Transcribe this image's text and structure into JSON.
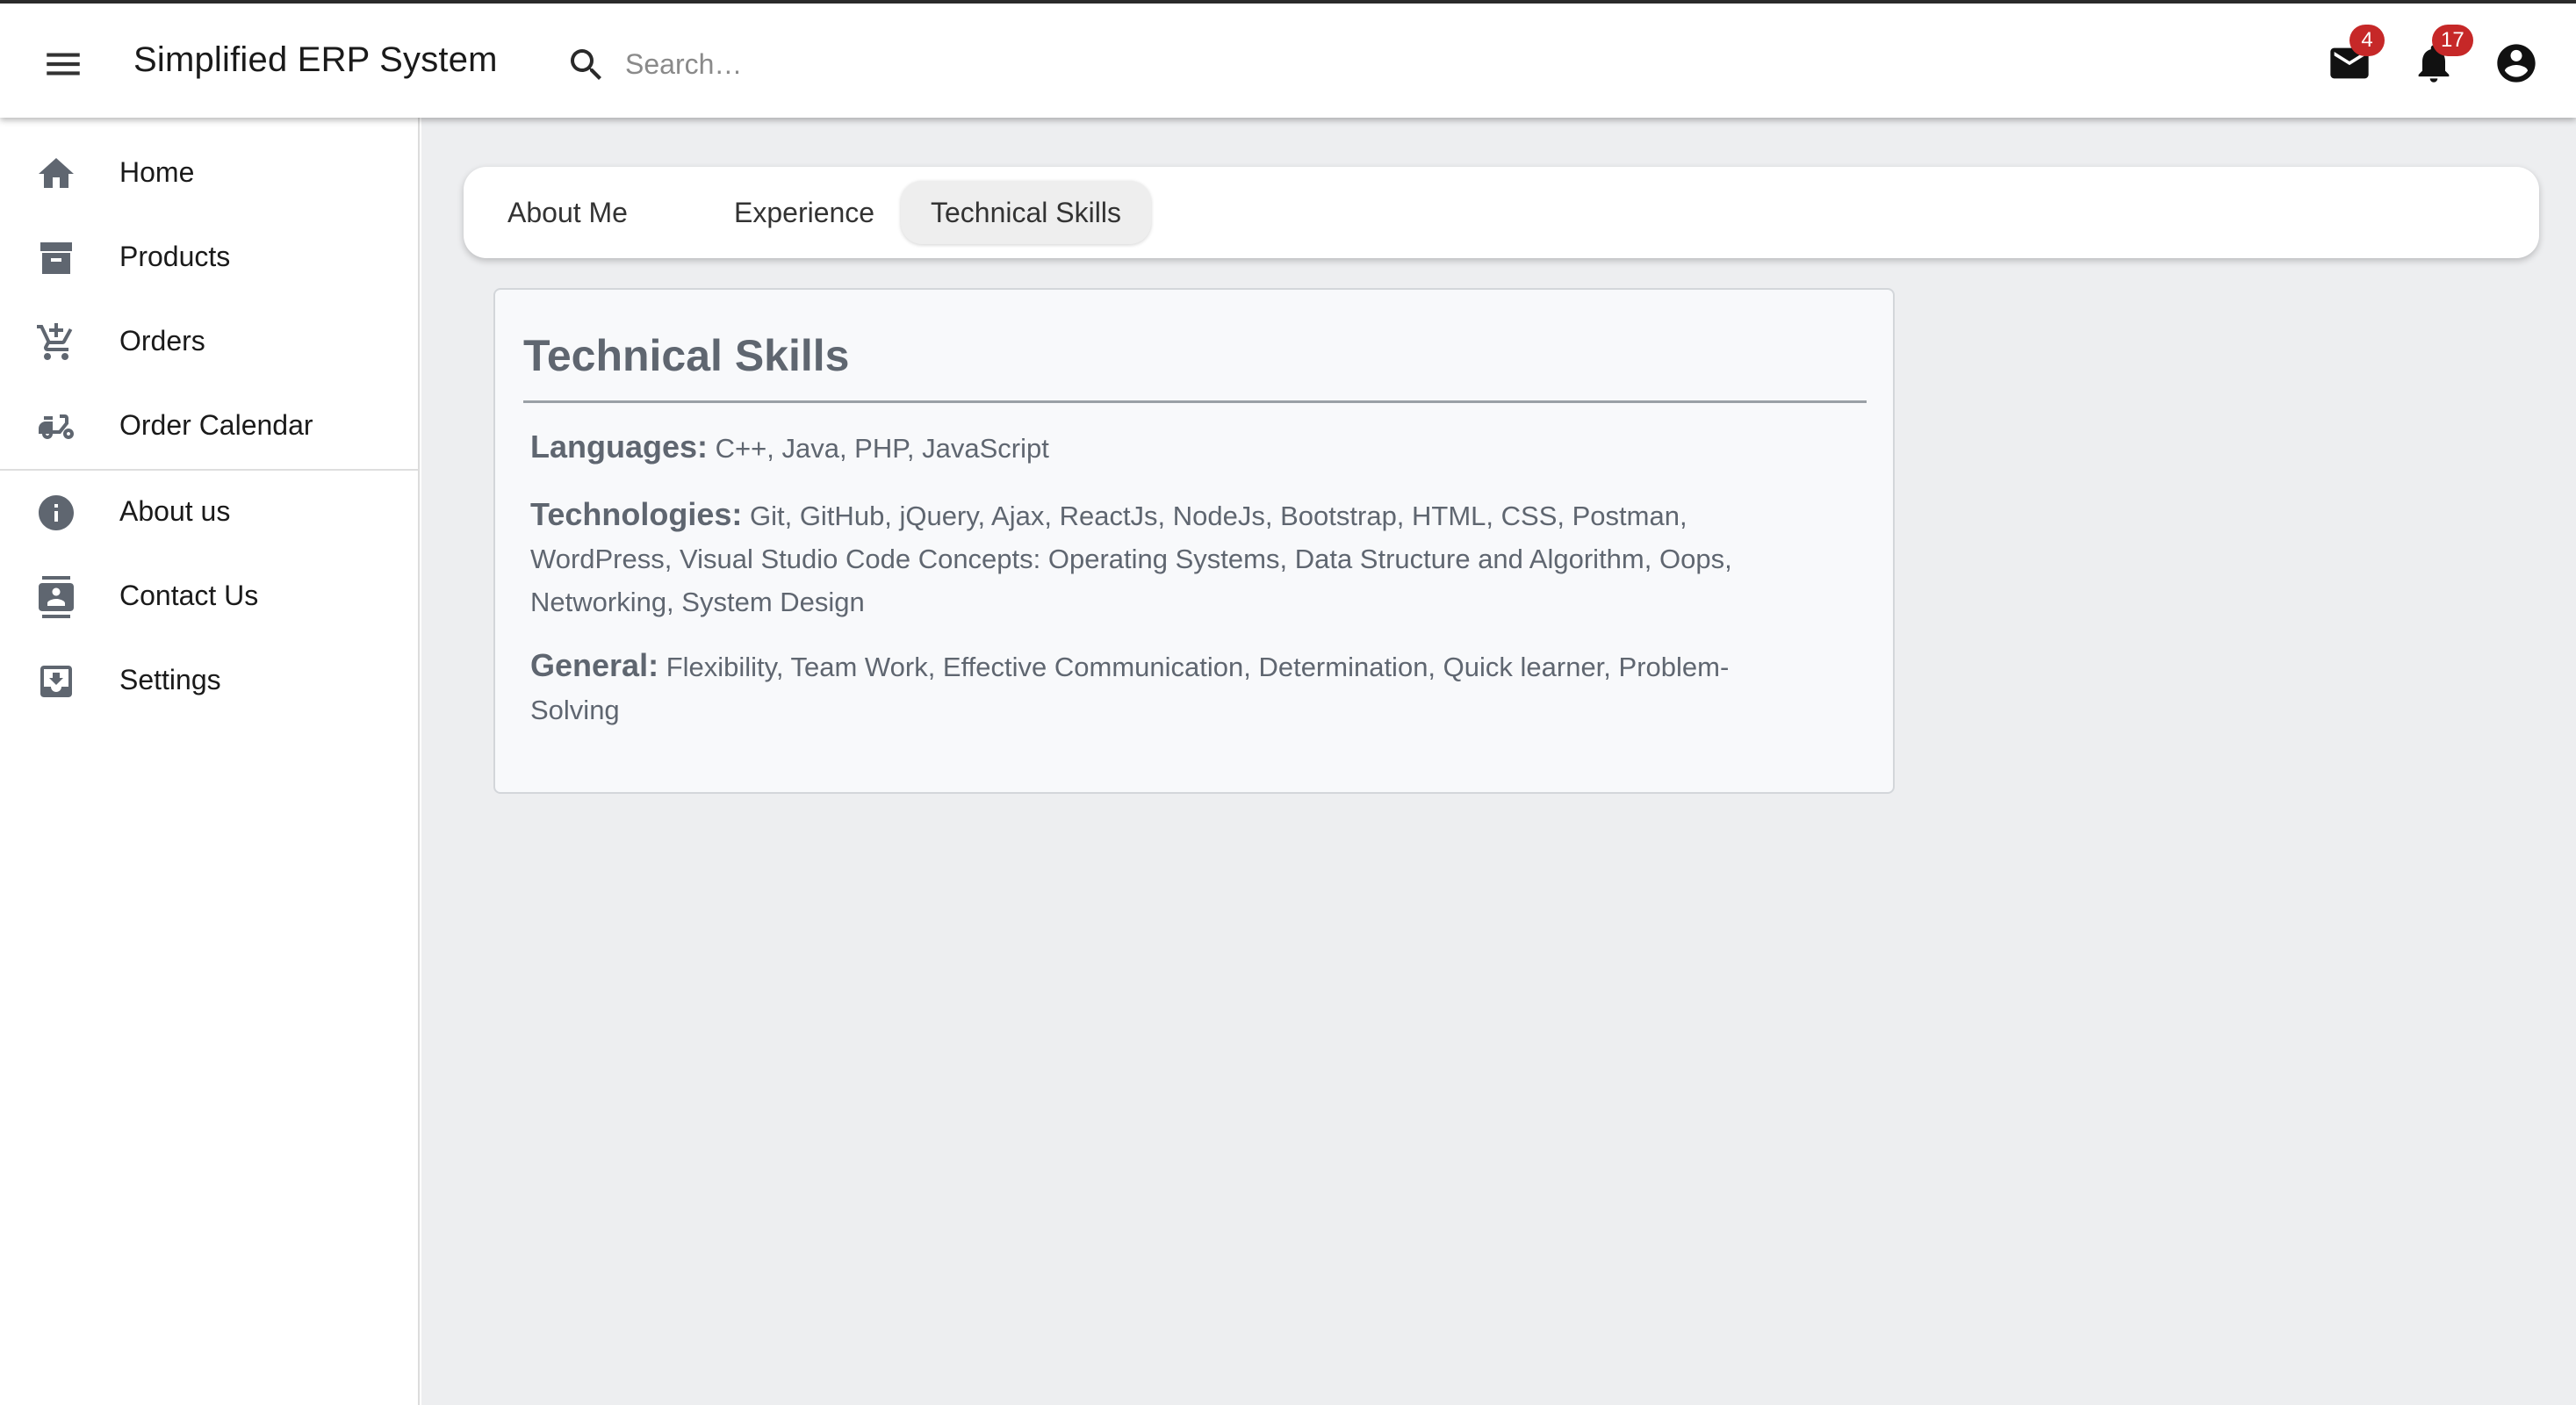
{
  "header": {
    "title": "Simplified ERP System",
    "menu_icon": "hamburger-menu-icon",
    "search": {
      "placeholder": "Search…",
      "value": ""
    },
    "mail": {
      "icon": "mail-icon",
      "badge": "4"
    },
    "notifications": {
      "icon": "bell-icon",
      "badge": "17"
    },
    "account": {
      "icon": "account-circle-icon"
    },
    "badge_color": "#c62828"
  },
  "sidebar": {
    "items": [
      {
        "label": "Home",
        "icon": "home-icon"
      },
      {
        "label": "Products",
        "icon": "archive-icon"
      },
      {
        "label": "Orders",
        "icon": "cart-icon"
      },
      {
        "label": "Order Calendar",
        "icon": "moped-icon"
      },
      {
        "label": "About us",
        "icon": "info-icon"
      },
      {
        "label": "Contact Us",
        "icon": "contact-card-icon"
      },
      {
        "label": "Settings",
        "icon": "inbox-download-icon"
      }
    ]
  },
  "tabs": [
    {
      "label": "About Me",
      "active": false
    },
    {
      "label": "Experience",
      "active": false
    },
    {
      "label": "Technical Skills",
      "active": true
    }
  ],
  "skills_card": {
    "title": "Technical Skills",
    "sections": [
      {
        "key": "Languages:",
        "value": "C++, Java, PHP, JavaScript"
      },
      {
        "key": "Technologies:",
        "value": "Git, GitHub, jQuery, Ajax, ReactJs, NodeJs, Bootstrap, HTML, CSS, Postman, WordPress, Visual Studio Code Concepts: Operating Systems, Data Structure and Algorithm, Oops, Networking, System Design"
      },
      {
        "key": "General:",
        "value": "Flexibility, Team Work, Effective Communication, Determination, Quick learner, Problem-Solving"
      }
    ]
  },
  "colors": {
    "main_background": "#edeef0",
    "card_background": "#f8f9fb",
    "card_text": "#5f6670"
  }
}
